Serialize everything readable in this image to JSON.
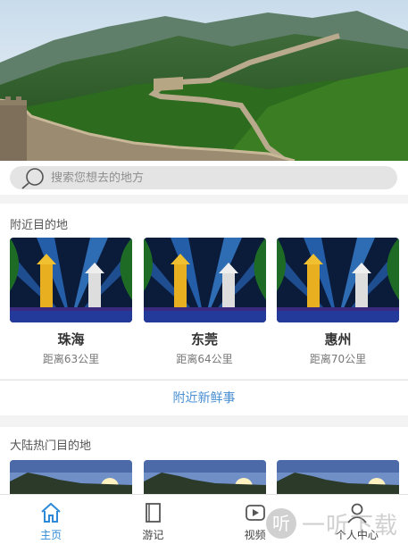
{
  "search": {
    "placeholder": "搜索您想去的地方"
  },
  "nearby": {
    "title": "附近目的地",
    "items": [
      {
        "city": "珠海",
        "distance": "距离63公里"
      },
      {
        "city": "东莞",
        "distance": "距离64公里"
      },
      {
        "city": "惠州",
        "distance": "距离70公里"
      }
    ],
    "more_label": "附近新鲜事"
  },
  "hot": {
    "title": "大陆热门目的地"
  },
  "tabbar": {
    "active_color": "#2e8ad8",
    "tabs": [
      {
        "label": "主页",
        "icon": "home-icon",
        "active": true
      },
      {
        "label": "游记",
        "icon": "book-icon",
        "active": false
      },
      {
        "label": "视频",
        "icon": "video-icon",
        "active": false
      },
      {
        "label": "个人中心",
        "icon": "user-icon",
        "active": false
      }
    ]
  },
  "watermark": {
    "badge": "听",
    "text": "一听下载"
  }
}
